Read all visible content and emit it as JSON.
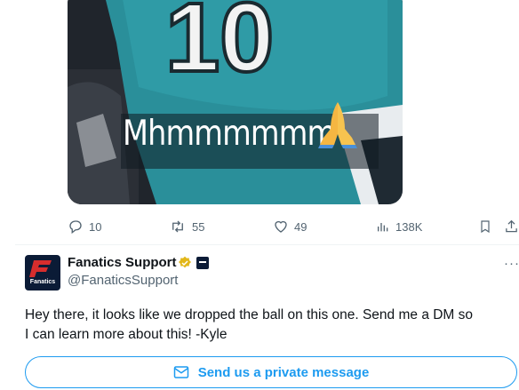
{
  "tweet": {
    "media": {
      "caption": "Mhmmmmmm",
      "emoji": "folded-hands",
      "jersey_number": "10"
    },
    "actions": {
      "replies": "10",
      "retweets": "55",
      "likes": "49",
      "views": "138K"
    }
  },
  "reply": {
    "author_name": "Fanatics Support",
    "handle": "@FanaticsSupport",
    "avatar_text": "Fanatics",
    "more": "···",
    "text_line1": "Hey there, it looks like we dropped the ball on this one. Send me a DM so",
    "text_line2": "I can learn more about this! -Kyle",
    "dm_button_label": "Send us a private message"
  },
  "colors": {
    "accent": "#1d9bf0",
    "muted": "#536471",
    "jersey": "#2a8f9a",
    "verified": "#e2b719"
  }
}
